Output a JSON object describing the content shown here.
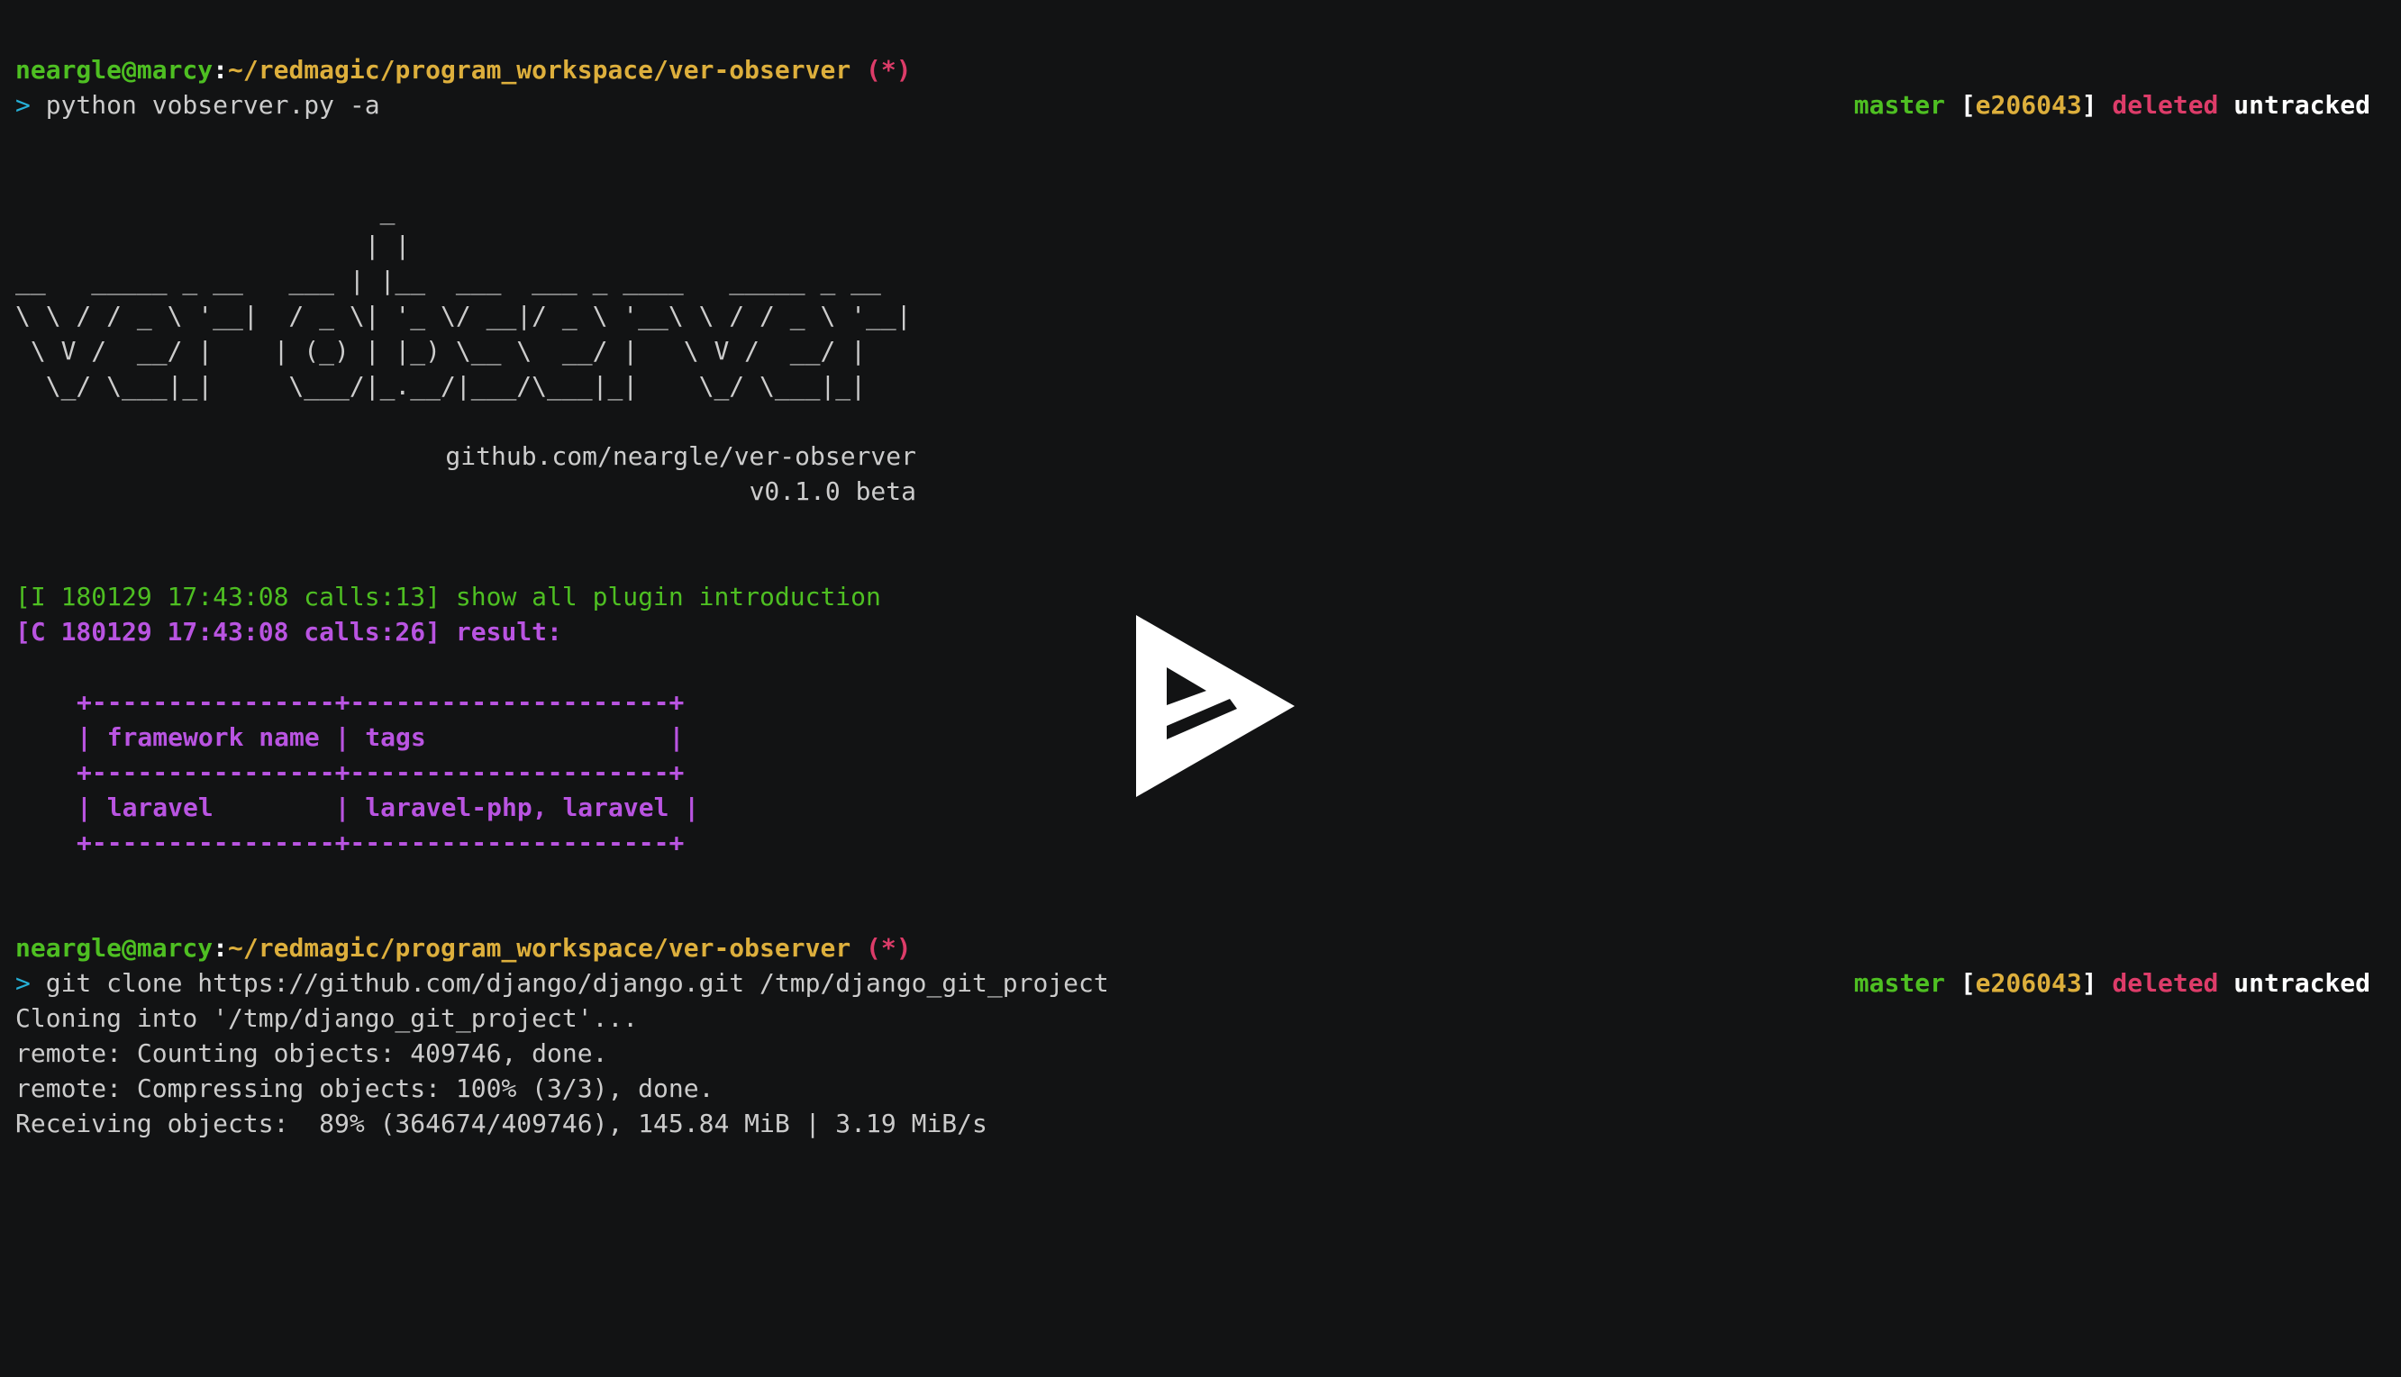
{
  "prompt1": {
    "user_host": "neargle@marcy",
    "sep": ":",
    "path": "~/redmagic/program_workspace/ver-observer",
    "flag": "(*)",
    "arrow": ">",
    "command": "python vobserver.py -a",
    "git": {
      "branch": "master",
      "open_bracket": "[",
      "hash": "e206043",
      "close_bracket": "]",
      "deleted": "deleted",
      "untracked": "untracked"
    }
  },
  "banner": {
    "ascii_art": [
      "                        _",
      "                       | |",
      "__   _____ _ __   ___ | |__  ___  ___ _ ____   _____ _ __",
      "\\ \\ / / _ \\ '__|  / _ \\| '_ \\/ __|/ _ \\ '__\\ \\ / / _ \\ '__|",
      " \\ V /  __/ |    | (_) | |_) \\__ \\  __/ |   \\ V /  __/ |",
      "  \\_/ \\___|_|     \\___/|_.__/|___/\\___|_|    \\_/ \\___|_|"
    ],
    "url": "github.com/neargle/ver-observer",
    "version": "v0.1.0 beta"
  },
  "log": {
    "info_line": "[I 180129 17:43:08 calls:13] show all plugin introduction",
    "result_line": "[C 180129 17:43:08 calls:26] result:"
  },
  "result_table": {
    "border": "+----------------+---------------------+",
    "header_row": "| framework name | tags                |",
    "data_row": "| laravel        | laravel-php, laravel |",
    "columns": [
      "framework name",
      "tags"
    ],
    "rows": [
      [
        "laravel",
        "laravel-php, laravel"
      ]
    ]
  },
  "prompt2": {
    "user_host": "neargle@marcy",
    "sep": ":",
    "path": "~/redmagic/program_workspace/ver-observer",
    "flag": "(*)",
    "arrow": ">",
    "command": "git clone https://github.com/django/django.git /tmp/django_git_project",
    "git": {
      "branch": "master",
      "open_bracket": "[",
      "hash": "e206043",
      "close_bracket": "]",
      "deleted": "deleted",
      "untracked": "untracked"
    }
  },
  "clone_output": [
    "Cloning into '/tmp/django_git_project'...",
    "remote: Counting objects: 409746, done.",
    "remote: Compressing objects: 100% (3/3), done.",
    "Receiving objects:  89% (364674/409746), 145.84 MiB | 3.19 MiB/s"
  ],
  "player": {
    "icon": "play-icon",
    "colors": {
      "background": "#121314",
      "icon": "#ffffff"
    }
  }
}
